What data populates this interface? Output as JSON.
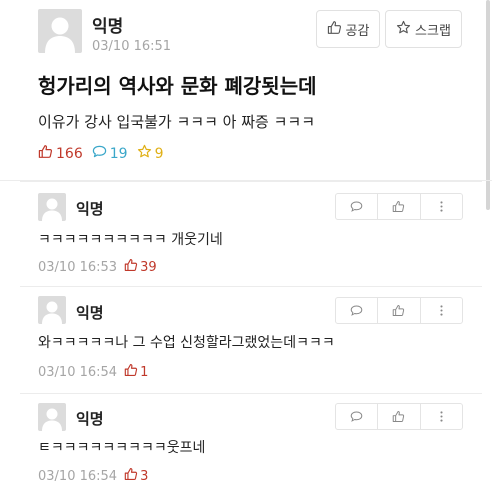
{
  "post": {
    "author": "익명",
    "time": "03/10 16:51",
    "title": "헝가리의 역사와 문화 폐강됫는데",
    "body": "이유가 강사 입국불가 ㅋㅋㅋ 아 짜증 ㅋㅋㅋ",
    "likes": "166",
    "comments": "19",
    "scraps": "9",
    "like_label": "공감",
    "scrap_label": "스크랩"
  },
  "comments": [
    {
      "author": "익명",
      "text": "ㅋㅋㅋㅋㅋㅋㅋㅋㅋㅋ 개웃기네",
      "time": "03/10 16:53",
      "likes": "39"
    },
    {
      "author": "익명",
      "text": "와ㅋㅋㅋㅋㅋ나 그 수업 신청할라그랬었는데ㅋㅋㅋ",
      "time": "03/10 16:54",
      "likes": "1"
    },
    {
      "author": "익명",
      "text": "ㅌㅋㅋㅋㅋㅋㅋㅋㅋㅋ웃프네",
      "time": "03/10 16:54",
      "likes": "3"
    }
  ],
  "colors": {
    "like": "#c0392b",
    "comment": "#3aa7c9",
    "scrap": "#e0b016",
    "muted": "#a5a5a5"
  },
  "icons": [
    "default-avatar-icon",
    "thumbs-up-icon",
    "star-icon",
    "speech-bubble-icon",
    "more-vertical-icon"
  ]
}
